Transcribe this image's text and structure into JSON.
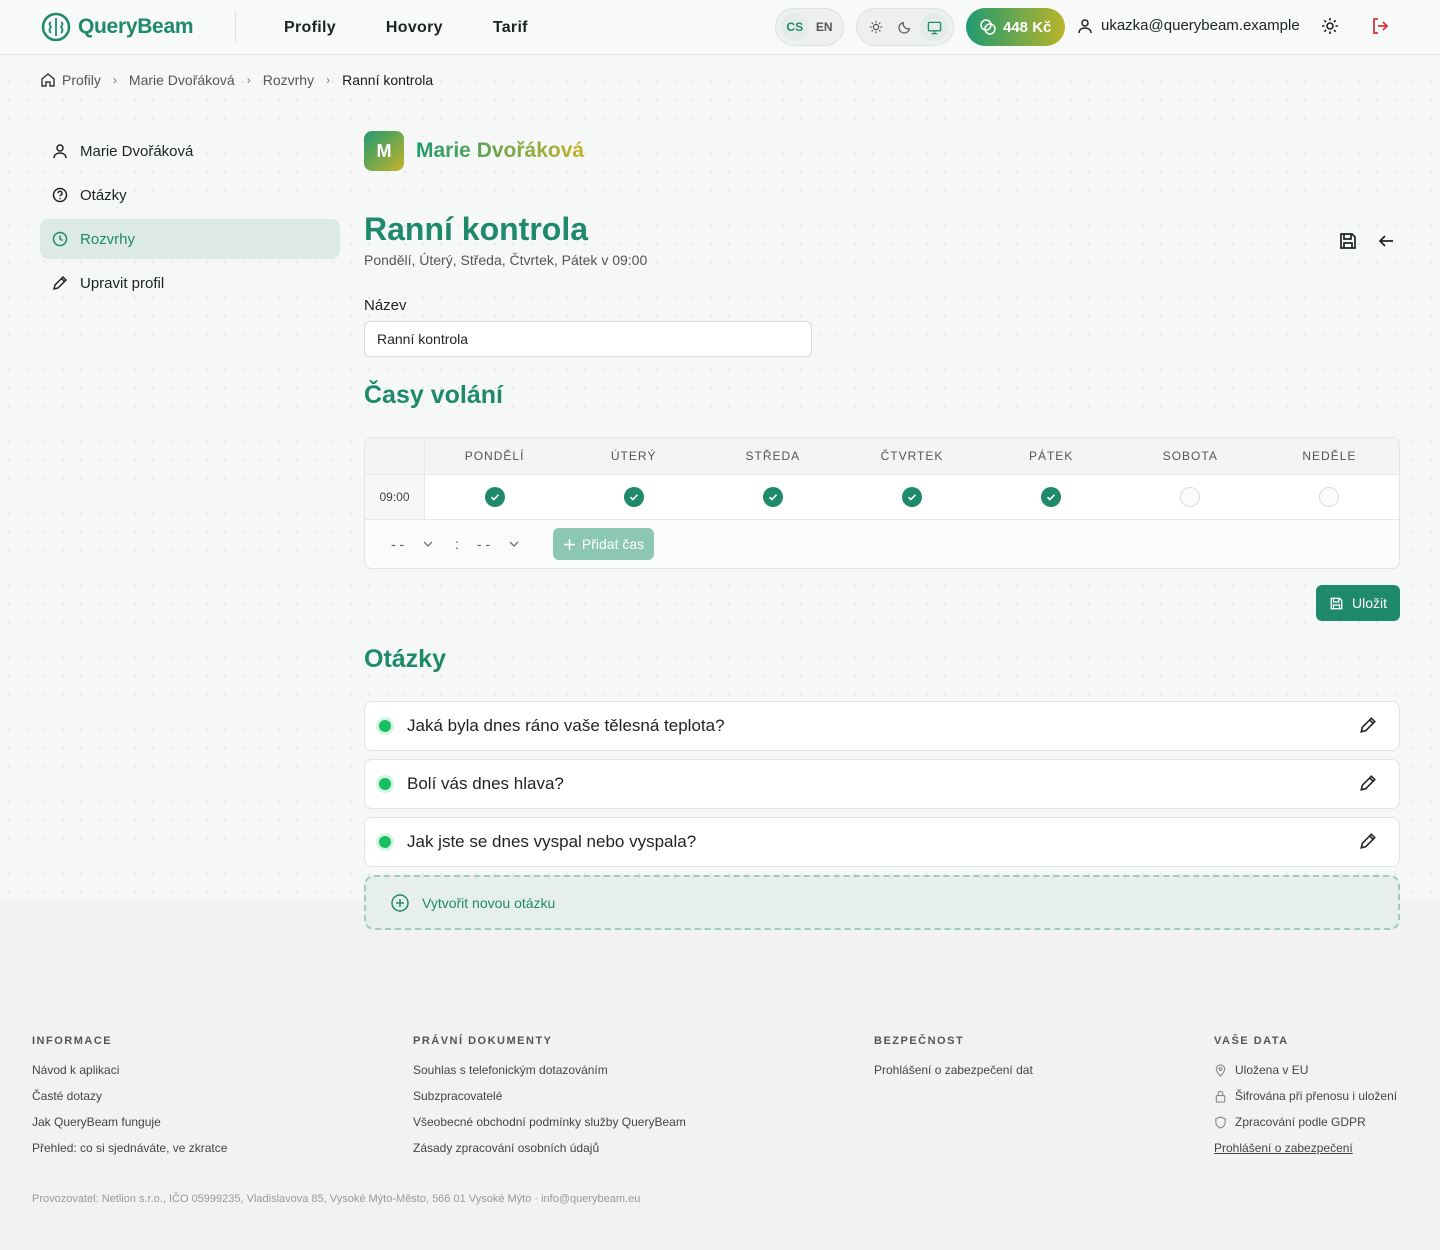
{
  "header": {
    "brand": "QueryBeam",
    "nav": [
      "Profily",
      "Hovory",
      "Tarif"
    ],
    "lang": [
      "CS",
      "EN"
    ],
    "credit": "448 Kč",
    "user_email": "ukazka@querybeam.example"
  },
  "breadcrumb": [
    "Profily",
    "Marie Dvořáková",
    "Rozvrhy",
    "Ranní kontrola"
  ],
  "sidebar": {
    "items": [
      {
        "label": "Marie Dvořáková",
        "icon": "user-icon"
      },
      {
        "label": "Otázky",
        "icon": "question-circle-icon"
      },
      {
        "label": "Rozvrhy",
        "icon": "clock-icon"
      },
      {
        "label": "Upravit profil",
        "icon": "pencil-icon"
      }
    ]
  },
  "profile": {
    "initial": "M",
    "first": "Marie",
    "last": "Dvořáková"
  },
  "schedule": {
    "title": "Ranní kontrola",
    "subtitle": "Pondělí, Úterý, Středa, Čtvrtek, Pátek v 09:00",
    "name_label": "Název",
    "name_value": "Ranní kontrola",
    "times_title": "Časy volání",
    "days": [
      "PONDĚLÍ",
      "ÚTERÝ",
      "STŘEDA",
      "ČTVRTEK",
      "PÁTEK",
      "SOBOTA",
      "NEDĚLE"
    ],
    "rows": [
      {
        "time": "09:00",
        "checked": [
          true,
          true,
          true,
          true,
          true,
          false,
          false
        ]
      }
    ],
    "hour_placeholder": "- -",
    "minute_placeholder": "- -",
    "colon": ":",
    "add_time_label": "Přidat čas",
    "save_label": "Uložit"
  },
  "questions": {
    "title": "Otázky",
    "items": [
      "Jaká byla dnes ráno vaše tělesná teplota?",
      "Bolí vás dnes hlava?",
      "Jak jste se dnes vyspal nebo vyspala?"
    ],
    "new_label": "Vytvořit novou otázku"
  },
  "footer": {
    "info": {
      "title": "INFORMACE",
      "links": [
        "Návod k aplikaci",
        "Časté dotazy",
        "Jak QueryBeam funguje",
        "Přehled: co si sjednáváte, ve zkratce"
      ]
    },
    "legal": {
      "title": "PRÁVNÍ DOKUMENTY",
      "links": [
        "Souhlas s telefonickým dotazováním",
        "Subzpracovatelé",
        "Všeobecné obchodní podmínky služby QueryBeam",
        "Zásady zpracování osobních údajů"
      ]
    },
    "security": {
      "title": "BEZPEČNOST",
      "links": [
        "Prohlášení o zabezpečení dat"
      ]
    },
    "data": {
      "title": "VAŠE DATA",
      "items": [
        "Uložena v EU",
        "Šifrována při přenosu i uložení",
        "Zpracování podle GDPR"
      ],
      "link": "Prohlášení o zabezpečení"
    },
    "operator": "Provozovatel: Netlion s.r.o., IČO 05999235, Vladislavova 85, Vysoké Mýto-Město, 566 01 Vysoké Mýto · info@querybeam.eu"
  },
  "colors": {
    "accent": "#1f8a6b",
    "gold": "#c4b32a",
    "danger": "#d9343b"
  }
}
